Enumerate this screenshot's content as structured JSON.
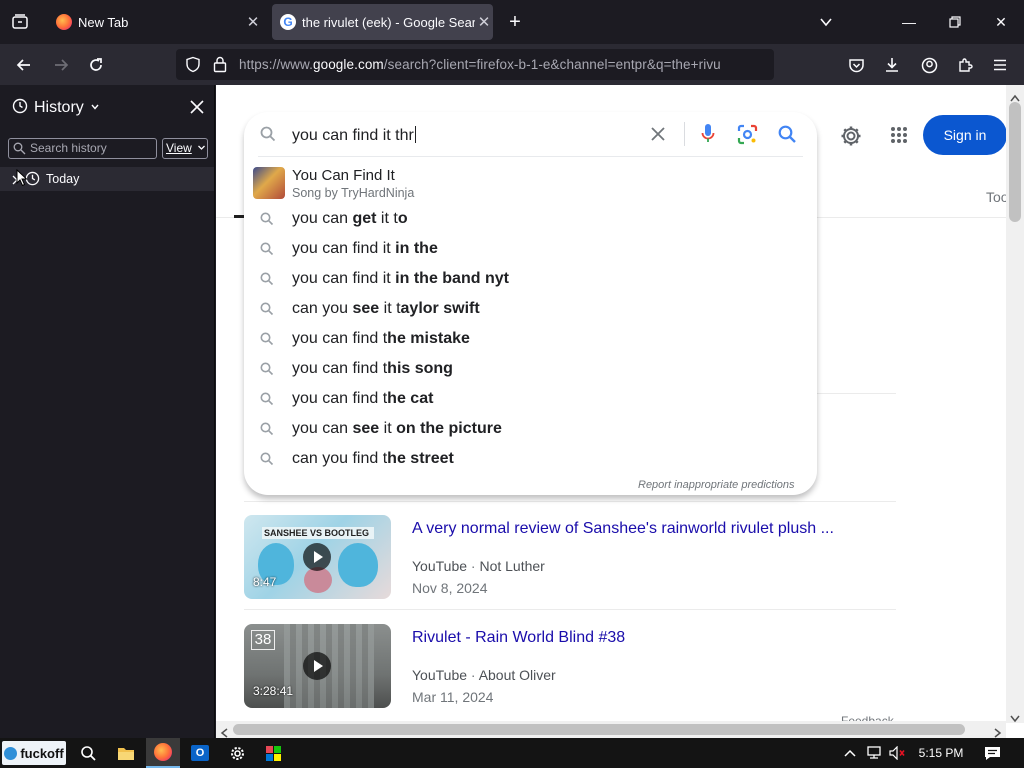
{
  "tabs": [
    {
      "title": "New Tab",
      "icon": "firefox-icon"
    },
    {
      "title": "the rivulet (eek) - Google Search",
      "icon": "google-icon"
    }
  ],
  "url": {
    "prefix": "https://www.",
    "host": "google.com",
    "rest": "/search?client=firefox-b-1-e&channel=entpr&q=the+rivu"
  },
  "sidebar": {
    "title": "History",
    "search_placeholder": "Search history",
    "view_label": "View",
    "groups": [
      "Today"
    ]
  },
  "google": {
    "query": "you can find it thr",
    "sign_in": "Sign in",
    "tools_label_partial": "Too",
    "top_suggestion": {
      "title": "You Can Find It",
      "subtitle": "Song by TryHardNinja"
    },
    "suggestions": [
      {
        "normal": "you can ",
        "bold": "get",
        "tail_normal": " it t",
        "tail_bold": "o"
      },
      {
        "normal": "you can find it ",
        "bold": "in the",
        "tail_normal": "",
        "tail_bold": ""
      },
      {
        "normal": "you can find it ",
        "bold": "in the band nyt",
        "tail_normal": "",
        "tail_bold": ""
      },
      {
        "normal": "can you ",
        "bold": "see",
        "tail_normal": " it t",
        "tail_bold": "aylor swift"
      },
      {
        "normal": "you can find t",
        "bold": "he mistake",
        "tail_normal": "",
        "tail_bold": ""
      },
      {
        "normal": "you can find t",
        "bold": "his song",
        "tail_normal": "",
        "tail_bold": ""
      },
      {
        "normal": "you can find t",
        "bold": "he cat",
        "tail_normal": "",
        "tail_bold": ""
      },
      {
        "normal": "you can ",
        "bold": "see",
        "tail_normal": " it ",
        "tail_bold": "on the picture"
      },
      {
        "normal": "can you find t",
        "bold": "he street",
        "tail_normal": "",
        "tail_bold": ""
      }
    ],
    "report_link": "Report inappropriate predictions",
    "results": [
      {
        "title": "A very normal review of Sanshee's rainworld rivulet plush ...",
        "source": "YouTube",
        "channel": "Not Luther",
        "date": "Nov 8, 2024",
        "duration": "8:47",
        "thumb_text": "SANSHEE VS BOOTLEG"
      },
      {
        "title": "Rivulet - Rain World Blind #38",
        "source": "YouTube",
        "channel": "About Oliver",
        "date": "Mar 11, 2024",
        "duration": "3:28:41",
        "thumb_text": "38"
      }
    ],
    "footer_partial": "Feedback"
  },
  "taskbar": {
    "start_label": "fuckoff",
    "time": "5:15 PM"
  },
  "colors": {
    "google_blue": "#1a0dab",
    "sign_in_bg": "#0b57d0",
    "browser_dark": "#1c1b22",
    "toolbar": "#2b2a33"
  }
}
